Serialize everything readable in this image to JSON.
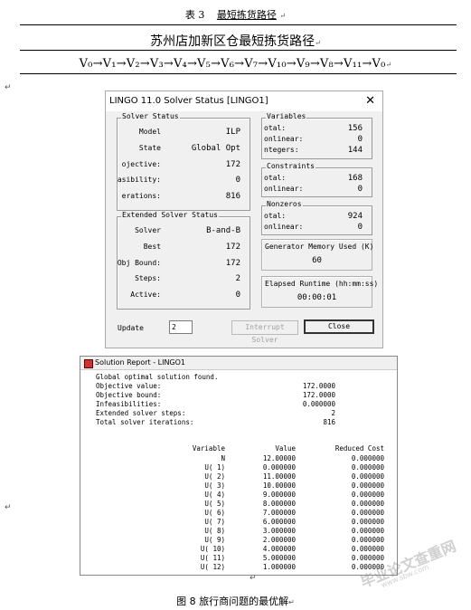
{
  "table": {
    "caption_num": "表 3",
    "caption_text": "最短拣货路径",
    "title": "苏州店加新区仓最短拣货路径",
    "route": "V₀→V₁→V₂→V₃→V₄→V₅→V₆→V₇→V₁₀→V₉→V₈→V₁₁→V₀"
  },
  "paragraph_mark": "↵",
  "status_window": {
    "title": "LINGO 11.0 Solver Status [LINGO1]",
    "close_glyph": "✕",
    "solver_status": {
      "group_title": "Solver Status",
      "rows": [
        {
          "label": "Model",
          "value": "ILP"
        },
        {
          "label": "State",
          "value": "Global Opt"
        },
        {
          "label": "ojective:",
          "value": "172"
        },
        {
          "label": "asibility:",
          "value": "0"
        },
        {
          "label": "erations:",
          "value": "816"
        }
      ]
    },
    "extended_status": {
      "group_title": "Extended Solver Status",
      "rows": [
        {
          "label": "Solver",
          "value": "B-and-B"
        },
        {
          "label": "Best",
          "value": "172"
        },
        {
          "label": "Obj Bound:",
          "value": "172"
        },
        {
          "label": "Steps:",
          "value": "2"
        },
        {
          "label": "Active:",
          "value": "0"
        }
      ]
    },
    "variables": {
      "group_title": "Variables",
      "rows": [
        {
          "label": "otal:",
          "value": "156"
        },
        {
          "label": "onlinear:",
          "value": "0"
        },
        {
          "label": "ntegers:",
          "value": "144"
        }
      ]
    },
    "constraints": {
      "group_title": "Constraints",
      "rows": [
        {
          "label": "otal:",
          "value": "168"
        },
        {
          "label": "onlinear:",
          "value": "0"
        }
      ]
    },
    "nonzeros": {
      "group_title": "Nonzeros",
      "rows": [
        {
          "label": "otal:",
          "value": "924"
        },
        {
          "label": "onlinear:",
          "value": "0"
        }
      ]
    },
    "memory": {
      "group_title": "Generator Memory Used (K)",
      "value": "60"
    },
    "runtime": {
      "group_title": "Elapsed Runtime (hh:mm:ss)",
      "value": "00:00:01"
    },
    "update_label": "Update",
    "update_value": "2",
    "interrupt_label": "Interrupt Solver",
    "close_label": "Close"
  },
  "report": {
    "title": "Solution Report - LINGO1",
    "summary": [
      {
        "label": "Global optimal solution found.",
        "value": ""
      },
      {
        "label": "Objective value:",
        "value": "172.0000"
      },
      {
        "label": "Objective bound:",
        "value": "172.0000"
      },
      {
        "label": "Infeasibilities:",
        "value": "0.000000"
      },
      {
        "label": "Extended solver steps:",
        "value": "2"
      },
      {
        "label": "Total solver iterations:",
        "value": "816"
      }
    ],
    "headers": {
      "variable": "Variable",
      "value": "Value",
      "reduced_cost": "Reduced Cost"
    },
    "rows": [
      {
        "variable": "N",
        "value": "12.00000",
        "reduced_cost": "0.000000"
      },
      {
        "variable": "U( 1)",
        "value": "0.000000",
        "reduced_cost": "0.000000"
      },
      {
        "variable": "U( 2)",
        "value": "11.00000",
        "reduced_cost": "0.000000"
      },
      {
        "variable": "U( 3)",
        "value": "10.00000",
        "reduced_cost": "0.000000"
      },
      {
        "variable": "U( 4)",
        "value": "9.000000",
        "reduced_cost": "0.000000"
      },
      {
        "variable": "U( 5)",
        "value": "8.000000",
        "reduced_cost": "0.000000"
      },
      {
        "variable": "U( 6)",
        "value": "7.000000",
        "reduced_cost": "0.000000"
      },
      {
        "variable": "U( 7)",
        "value": "6.000000",
        "reduced_cost": "0.000000"
      },
      {
        "variable": "U( 8)",
        "value": "3.000000",
        "reduced_cost": "0.000000"
      },
      {
        "variable": "U( 9)",
        "value": "2.000000",
        "reduced_cost": "0.000000"
      },
      {
        "variable": "U( 10)",
        "value": "4.000000",
        "reduced_cost": "0.000000"
      },
      {
        "variable": "U( 11)",
        "value": "5.000000",
        "reduced_cost": "0.000000"
      },
      {
        "variable": "U( 12)",
        "value": "1.000000",
        "reduced_cost": "0.000000"
      }
    ]
  },
  "figure_caption": "图 8  旅行商问题的最优解",
  "watermark": {
    "main": "毕业论文查重网",
    "sub": "www.sbw.com"
  }
}
